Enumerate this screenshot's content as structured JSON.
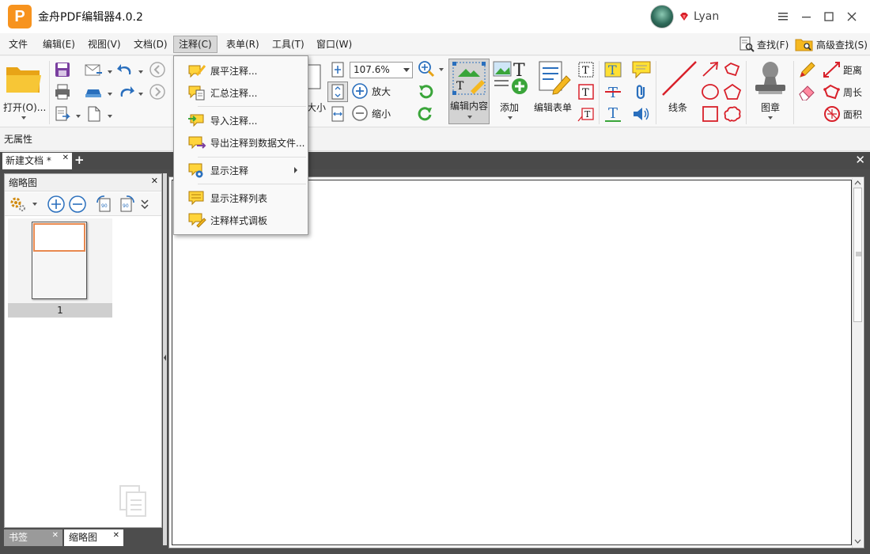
{
  "app": {
    "logo_letter": "P",
    "title": "金舟PDF编辑器4.0.2",
    "user_name": "Lyan"
  },
  "menubar": {
    "items": [
      "文件",
      "编辑(E)",
      "视图(V)",
      "文档(D)",
      "注释(C)",
      "表单(R)",
      "工具(T)",
      "窗口(W)"
    ],
    "active": "注释(C)",
    "find_label": "查找(F)",
    "advanced_find_label": "高级查找(S)"
  },
  "ribbon": {
    "open_label": "打开(O)...",
    "size_label": "大小",
    "zoom_value": "107.6%",
    "zoom_in_label": "放大",
    "zoom_out_label": "缩小",
    "edit_content_label": "编辑内容",
    "add_label": "添加",
    "edit_form_label": "编辑表单",
    "line_label": "线条",
    "stamp_label": "图章",
    "distance_label": "距离",
    "perimeter_label": "周长",
    "area_label": "面积"
  },
  "property_bar": {
    "text": "无属性"
  },
  "tabs": {
    "document_tab": "新建文档 *",
    "add_tab": "+"
  },
  "left_panel": {
    "title": "缩略图",
    "page_number": "1",
    "tabs": [
      "书签",
      "缩略图"
    ]
  },
  "annotation_menu": {
    "items": [
      {
        "label": "展平注释...",
        "icon": "flatten-annotation-icon"
      },
      {
        "label": "汇总注释...",
        "icon": "summarize-annotation-icon"
      },
      {
        "label": "导入注释...",
        "icon": "import-annotation-icon"
      },
      {
        "label": "导出注释到数据文件...",
        "icon": "export-annotation-icon"
      },
      {
        "label": "显示注释",
        "icon": "show-annotation-icon",
        "has_submenu": true
      },
      {
        "label": "显示注释列表",
        "icon": "annotation-list-icon"
      },
      {
        "label": "注释样式调板",
        "icon": "annotation-style-icon"
      }
    ]
  },
  "colors": {
    "accent_orange": "#f7931e",
    "folder_yellow": "#f5b820",
    "red_tools": "#d8202a",
    "blue_tools": "#2a6fbd",
    "green_tools": "#3aa53a",
    "tab_strip": "#4a4a4a"
  }
}
